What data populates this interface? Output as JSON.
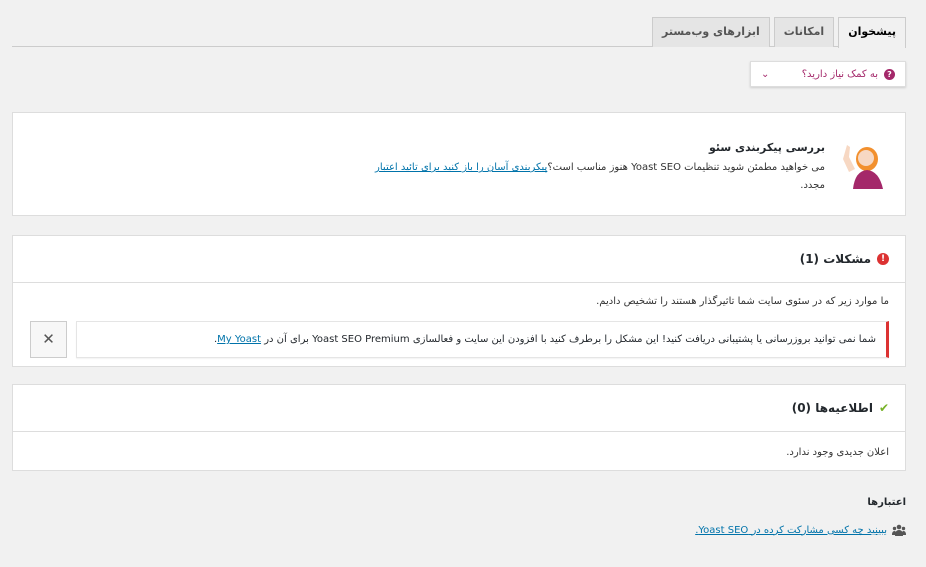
{
  "tabs": [
    {
      "label": "پیشخوان",
      "active": true
    },
    {
      "label": "امکانات",
      "active": false
    },
    {
      "label": "ابزارهای وب‌مستر",
      "active": false
    }
  ],
  "help": {
    "label": "به کمک نیاز دارید؟",
    "icon": "question-icon"
  },
  "config": {
    "title": "بررسی پیکربندی سئو",
    "desc_prefix": "می خواهید مطمئن شوید تنظیمات Yoast SEO هنوز مناسب است؟",
    "desc_link": "پیکربندی آسان را باز کنید برای تائید اعتبار",
    "desc_suffix": "مجدد."
  },
  "problems": {
    "title": "مشکلات (1)",
    "intro": "ما موارد زیر که در سئوی سایت شما تاثیرگذار هستند را تشخیص دادیم.",
    "item_text": "شما نمی توانید بروزرسانی یا پشتیبانی دریافت کنید! این مشکل را برطرف کنید با افزودن این سایت و فعالسازی Yoast SEO Premium برای آن در",
    "item_link": "My Yoast",
    "item_end": ".",
    "dismiss": "✕"
  },
  "notifications": {
    "title": "اطلاعیه‌ها (0)",
    "empty": "اعلان جدیدی وجود ندارد."
  },
  "credits": {
    "title": "اعتبارها",
    "link": "ببینید چه کسی مشارکت کرده در Yoast SEO."
  },
  "colors": {
    "accent": "#a4286a",
    "error": "#dc3232",
    "success": "#77b227",
    "link": "#0073aa"
  }
}
